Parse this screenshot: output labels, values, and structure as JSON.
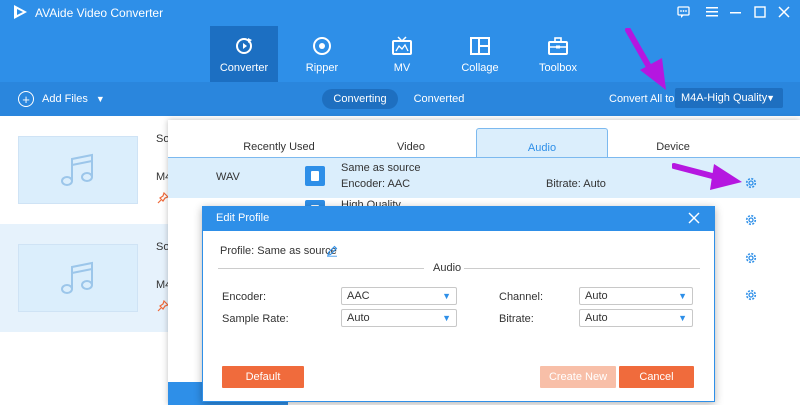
{
  "app": {
    "title": "AVAide Video Converter",
    "accent_color": "#2e8fe8"
  },
  "window_controls": [
    "feedback-icon",
    "menu-icon",
    "minimize-icon",
    "maximize-icon",
    "close-icon"
  ],
  "nav": {
    "tabs": [
      {
        "label": "Converter",
        "icon": "converter-icon",
        "active": true
      },
      {
        "label": "Ripper",
        "icon": "disc-icon",
        "active": false
      },
      {
        "label": "MV",
        "icon": "tv-icon",
        "active": false
      },
      {
        "label": "Collage",
        "icon": "collage-icon",
        "active": false
      },
      {
        "label": "Toolbox",
        "icon": "toolbox-icon",
        "active": false
      }
    ]
  },
  "toolbar": {
    "add_files": "Add Files",
    "seg_converting": "Converting",
    "seg_converted": "Converted",
    "convert_all_label": "Convert All to:",
    "convert_all_value": "M4A-High Quality"
  },
  "files": [
    {
      "name": "So",
      "format": "M4"
    },
    {
      "name": "So",
      "format": "M4"
    }
  ],
  "format_panel": {
    "tabs": [
      "Recently Used",
      "Video",
      "Audio",
      "Device"
    ],
    "active_tab": "Audio",
    "selected_format": "WAV",
    "presets": [
      {
        "name": "Same as source",
        "encoder": "Encoder: AAC",
        "bitrate": "Bitrate: Auto"
      },
      {
        "name": "High Quality"
      }
    ]
  },
  "dialog": {
    "title": "Edit Profile",
    "profile_label": "Profile: Same as source",
    "section_title": "Audio",
    "encoder_label": "Encoder:",
    "encoder_value": "AAC",
    "channel_label": "Channel:",
    "channel_value": "Auto",
    "sample_rate_label": "Sample Rate:",
    "sample_rate_value": "Auto",
    "bitrate_label": "Bitrate:",
    "bitrate_value": "Auto",
    "default_btn": "Default",
    "create_btn": "Create New",
    "cancel_btn": "Cancel"
  },
  "colors": {
    "topbar": "#2e8fe8",
    "nav_active": "#1c6fc2",
    "button_orange": "#f06b3c",
    "annotation_arrow": "#b517e0"
  }
}
